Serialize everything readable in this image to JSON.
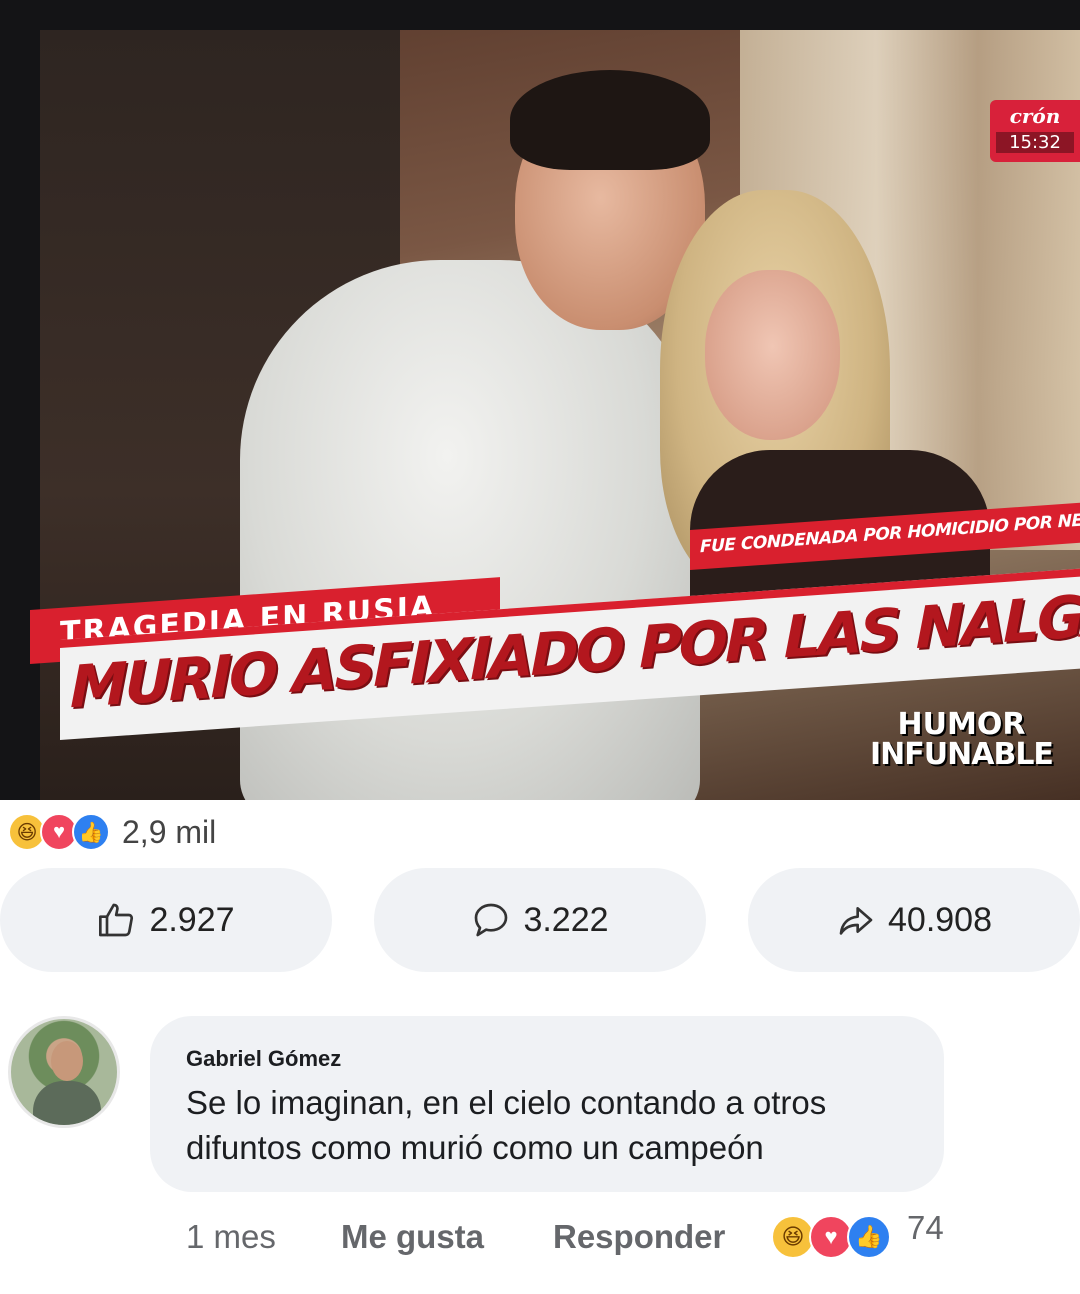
{
  "post": {
    "image": {
      "channel_logo": "crón",
      "clock": "15:32",
      "chyron_tag": "TRAGEDIA EN RUSIA",
      "chyron_sub": "FUE CONDENADA POR HOMICIDIO POR NEGLIGENCIA",
      "chyron_headline": "MURIO ASFIXIADO POR LAS NALGAS DE SU ESPOSA",
      "watermark_line1": "HUMOR",
      "watermark_line2": "INFUNABLE"
    },
    "reactions_summary": {
      "icons": [
        "haha-icon",
        "love-icon",
        "like-icon"
      ],
      "count": "2,9 mil"
    },
    "actions": {
      "likes": "2.927",
      "comments": "3.222",
      "shares": "40.908"
    }
  },
  "comment": {
    "author": "Gabriel Gómez",
    "text": "Se lo imaginan, en el cielo contando a otros difuntos como murió como un campeón",
    "time": "1 mes",
    "like_label": "Me gusta",
    "reply_label": "Responder",
    "reaction_count": "74"
  },
  "colors": {
    "chyron_red": "#d9202e",
    "pill_bg": "#f0f2f5",
    "like_blue": "#2e80f0",
    "love_red": "#f0455e",
    "haha_yellow": "#f7c13b"
  }
}
